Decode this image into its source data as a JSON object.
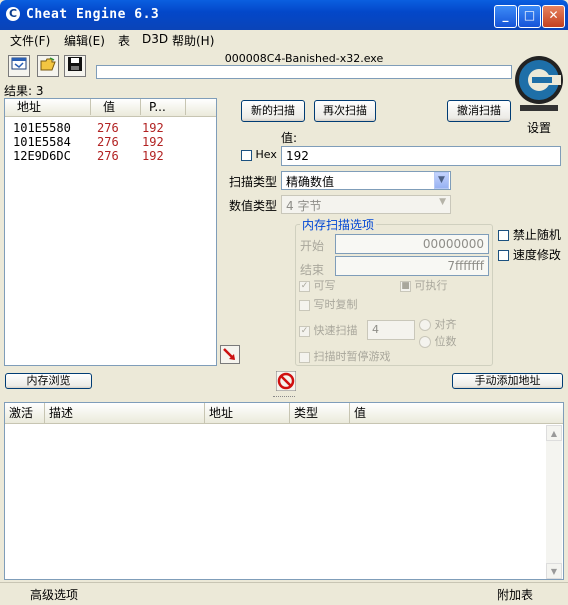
{
  "window": {
    "title": "Cheat Engine 6.3"
  },
  "menu": [
    "文件(F)",
    "编辑(E)",
    "表",
    "D3D",
    "帮助(H)"
  ],
  "process": {
    "name": "000008C4-Banished-x32.exe"
  },
  "results": {
    "label": "结果: 3"
  },
  "scan_list": {
    "headers": [
      "地址",
      "值",
      "P..."
    ],
    "rows": [
      {
        "address": "101E5580",
        "value": "276",
        "previous": "192"
      },
      {
        "address": "101E5584",
        "value": "276",
        "previous": "192"
      },
      {
        "address": "12E9D6DC",
        "value": "276",
        "previous": "192"
      }
    ]
  },
  "buttons": {
    "new_scan": "新的扫描",
    "next_scan": "再次扫描",
    "undo_scan": "撤消扫描",
    "settings": "设置",
    "memory_view": "内存浏览",
    "add_address": "手动添加地址"
  },
  "value_section": {
    "label": "值:",
    "hex_label": "Hex",
    "value": "192",
    "scan_type_label": "扫描类型",
    "scan_type": "精确数值",
    "value_type_label": "数值类型",
    "value_type": "4 字节"
  },
  "memory_options": {
    "title": "内存扫描选项",
    "start_label": "开始",
    "start_value": "00000000",
    "stop_label": "结束",
    "stop_value": "7fffffff",
    "writable": "可写",
    "executable": "可执行",
    "copy_on_write": "写时复制",
    "fast_scan": "快速扫描",
    "fast_scan_value": "4",
    "alignment": "对齐",
    "last_digits": "位数",
    "pause_game": "扫描时暂停游戏"
  },
  "side_options": {
    "disable_random": "禁止随机",
    "speed_hack": "速度修改"
  },
  "cheat_table": {
    "headers": [
      "激活",
      "描述",
      "地址",
      "类型",
      "值"
    ]
  },
  "status": {
    "advanced": "高级选项",
    "table_extras": "附加表"
  },
  "icons": [
    "app-icon",
    "process-icon",
    "open-folder-icon",
    "save-disk-icon",
    "cheat-engine-logo",
    "pointer-arrow-icon",
    "stop-icon"
  ],
  "colors": {
    "titlebar": "#0347c9",
    "face": "#ece9d8",
    "value_red": "#b22222",
    "logo_blue": "#1e6fa8"
  }
}
